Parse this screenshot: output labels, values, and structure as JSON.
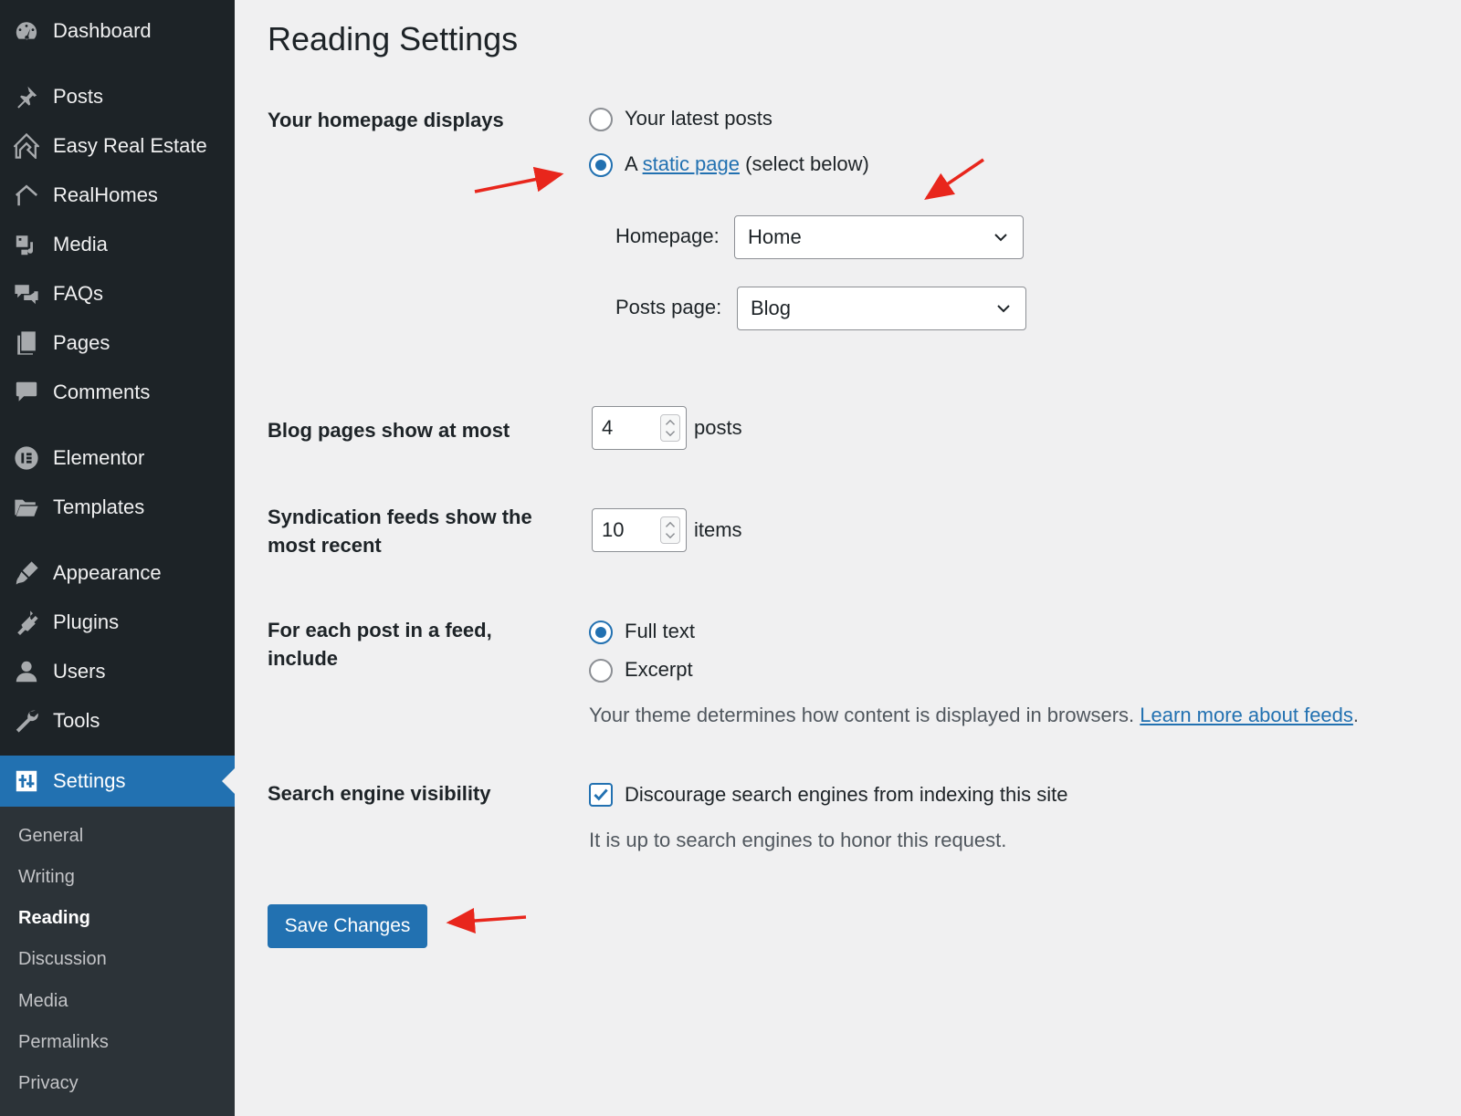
{
  "sidebar": {
    "items": [
      {
        "label": "Dashboard",
        "icon": "dashboard-icon"
      },
      {
        "label": "Posts",
        "icon": "pin-icon"
      },
      {
        "label": "Easy Real Estate",
        "icon": "house-icon"
      },
      {
        "label": "RealHomes",
        "icon": "house-outline-icon"
      },
      {
        "label": "Media",
        "icon": "media-icon"
      },
      {
        "label": "FAQs",
        "icon": "chat-bubbles-icon"
      },
      {
        "label": "Pages",
        "icon": "pages-icon"
      },
      {
        "label": "Comments",
        "icon": "comment-icon"
      },
      {
        "label": "Elementor",
        "icon": "elementor-icon"
      },
      {
        "label": "Templates",
        "icon": "folder-icon"
      },
      {
        "label": "Appearance",
        "icon": "brush-icon"
      },
      {
        "label": "Plugins",
        "icon": "plug-icon"
      },
      {
        "label": "Users",
        "icon": "user-icon"
      },
      {
        "label": "Tools",
        "icon": "wrench-icon"
      },
      {
        "label": "Settings",
        "icon": "settings-sliders-icon"
      }
    ],
    "submenu": [
      "General",
      "Writing",
      "Reading",
      "Discussion",
      "Media",
      "Permalinks",
      "Privacy"
    ],
    "current_submenu": "Reading"
  },
  "page": {
    "title": "Reading Settings"
  },
  "homepage": {
    "label": "Your homepage displays",
    "option_latest": "Your latest posts",
    "option_static_prefix": "A",
    "option_static_link": "static page",
    "option_static_suffix": "(select below)",
    "selected": "static",
    "homepage_label": "Homepage:",
    "homepage_value": "Home",
    "posts_page_label": "Posts page:",
    "posts_page_value": "Blog"
  },
  "blog_pages": {
    "label": "Blog pages show at most",
    "value": "4",
    "unit": "posts"
  },
  "syndication": {
    "label_line1": "Syndication feeds show the",
    "label_line2": "most recent",
    "value": "10",
    "unit": "items"
  },
  "feed_content": {
    "label_line1": "For each post in a feed,",
    "label_line2": "include",
    "option_full": "Full text",
    "option_excerpt": "Excerpt",
    "selected": "full",
    "description": "Your theme determines how content is displayed in browsers.",
    "learn_link": "Learn more about feeds",
    "learn_suffix": "."
  },
  "search_visibility": {
    "label": "Search engine visibility",
    "checkbox_label": "Discourage search engines from indexing this site",
    "checked": true,
    "description": "It is up to search engines to honor this request."
  },
  "actions": {
    "save_label": "Save Changes"
  },
  "colors": {
    "accent": "#2271b1",
    "sidebar": "#1d2327",
    "annotation_arrow": "#e8261c"
  }
}
